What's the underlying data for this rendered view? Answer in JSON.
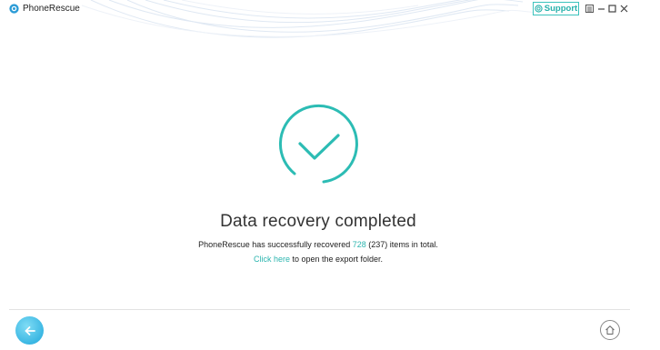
{
  "app": {
    "title": "PhoneRescue",
    "logo_icon": "phonerescue-logo-icon"
  },
  "titlebar": {
    "support_label": "Support",
    "support_icon": "lifebuoy-icon",
    "controls": [
      "menu-icon",
      "minimize-icon",
      "maximize-icon",
      "close-icon"
    ]
  },
  "result": {
    "status_icon": "check-circle-icon",
    "heading": "Data recovery completed",
    "summary_prefix": "PhoneRescue has successfully recovered ",
    "recovered_count": "728",
    "summary_suffix": " (237) items in total.",
    "link_text": "Click here",
    "link_suffix": " to open the export folder."
  },
  "footer": {
    "back_icon": "arrow-left-icon",
    "home_icon": "home-icon"
  },
  "colors": {
    "accent": "#2cb5af",
    "back_button": "#3bb7e3"
  }
}
